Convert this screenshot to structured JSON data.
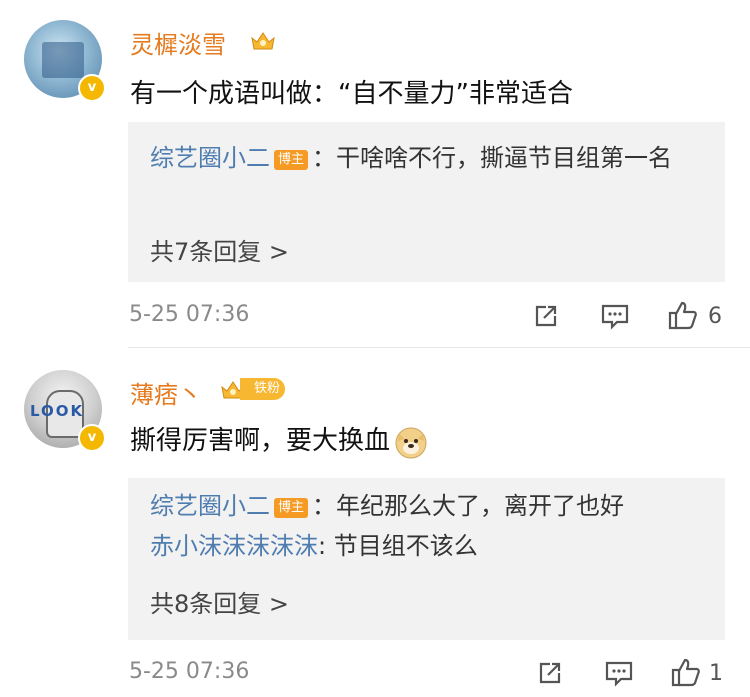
{
  "comments": [
    {
      "username": "灵樨淡雪",
      "verified": "v",
      "content": "有一个成语叫做：“自不量力”非常适合",
      "replies": [
        {
          "name": "综艺圈小二",
          "tag": "博主",
          "text": "：干啥啥不行，撕逼节目组第一名"
        }
      ],
      "more": "共7条回复 >",
      "time": "5-25 07:36",
      "likes": "6"
    },
    {
      "username": "薄痞丶",
      "verified": "v",
      "fan_badge": "铁粉",
      "content": "撕得厉害啊，要大换血",
      "replies": [
        {
          "name": "综艺圈小二",
          "tag": "博主",
          "text": "：年纪那么大了，离开了也好"
        },
        {
          "name": "赤小沫沫沫沫沫",
          "text": ": 节目组不该么"
        }
      ],
      "more": "共8条回复 >",
      "time": "5-25 07:36",
      "likes": "1"
    }
  ],
  "avatar2_text": "LOOK",
  "colors": {
    "username": "#e57a1f",
    "reply_name": "#507daf",
    "badge": "#f59a23",
    "verified": "#f5b800"
  }
}
